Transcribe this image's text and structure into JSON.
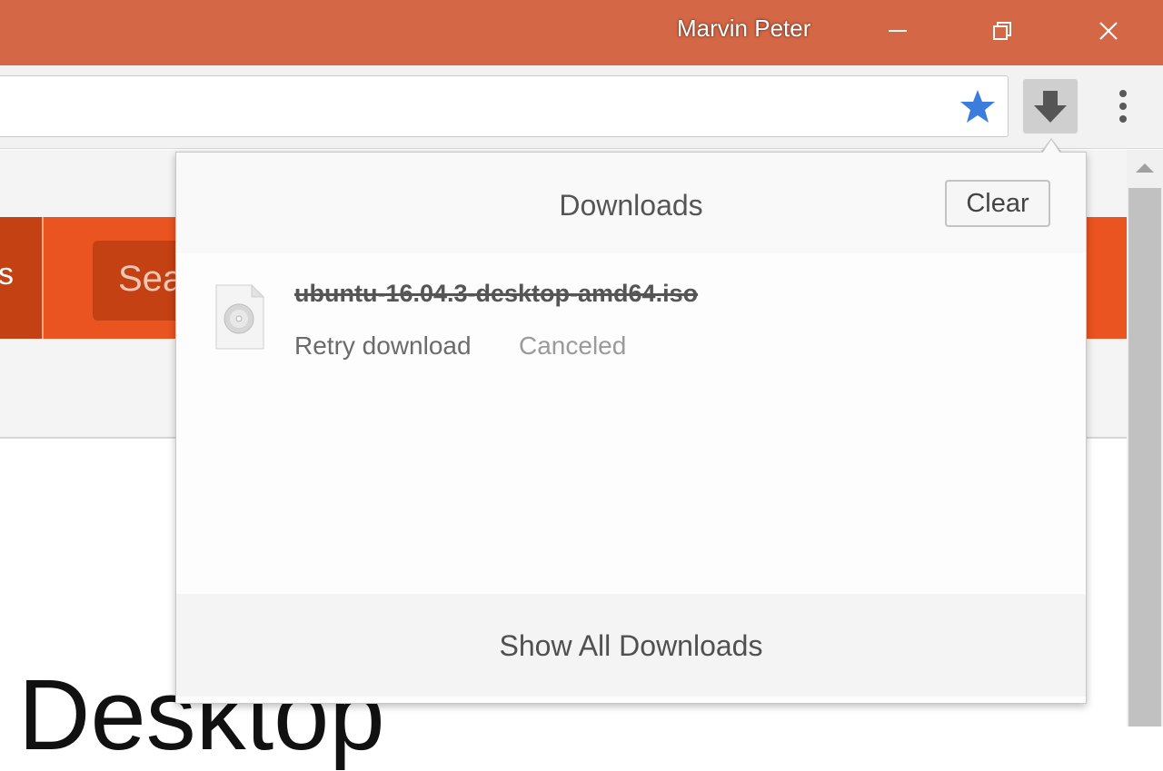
{
  "titlebar": {
    "profile_name": "Marvin Peter",
    "minimize_icon": "minimize-icon",
    "restore_icon": "restore-icon",
    "close_icon": "close-icon",
    "color": "#d46846"
  },
  "toolbar": {
    "bookmark_icon": "star-icon",
    "bookmark_color": "#3b7ddd",
    "download_icon": "download-arrow-icon",
    "menu_icon": "kebab-menu-icon"
  },
  "page": {
    "tab_label_fragment": "s",
    "search_fragment": "Sea",
    "heading_fragment": "Desktop",
    "accent_color": "#e95420"
  },
  "downloads": {
    "title": "Downloads",
    "clear_label": "Clear",
    "items": [
      {
        "file_name": "ubuntu-16.04.3-desktop-amd64.iso",
        "action_label": "Retry download",
        "status": "Canceled",
        "icon": "disc-file-icon"
      }
    ],
    "show_all_label": "Show All Downloads"
  }
}
